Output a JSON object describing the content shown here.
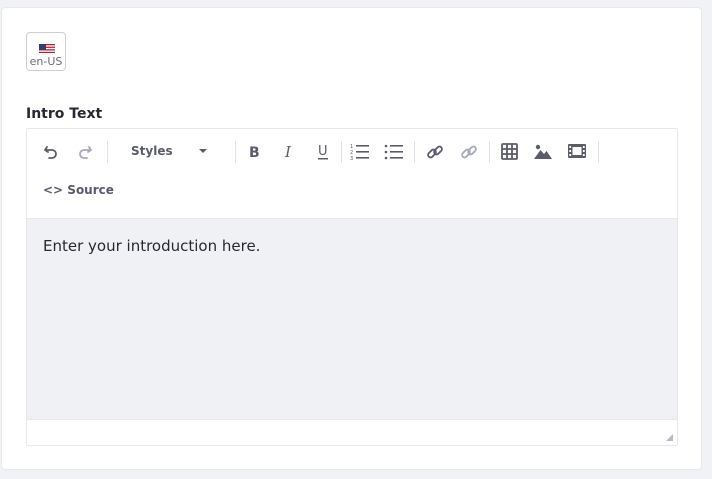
{
  "language": {
    "code": "en-US",
    "flag_icon": "us-flag-icon"
  },
  "field": {
    "label": "Intro Text"
  },
  "toolbar": {
    "styles_label": "Styles",
    "source_label": "Source",
    "icons": [
      "undo-icon",
      "redo-icon",
      "bold-icon",
      "italic-icon",
      "underline-icon",
      "numbered-list-icon",
      "bulleted-list-icon",
      "link-icon",
      "unlink-icon",
      "table-icon",
      "image-icon",
      "video-icon",
      "code-icon"
    ]
  },
  "editor": {
    "placeholder": "Enter your introduction here."
  },
  "colors": {
    "accent": "#272833",
    "toolbar_icon": "#5b5c6b",
    "content_bg": "#f0f1f5"
  }
}
